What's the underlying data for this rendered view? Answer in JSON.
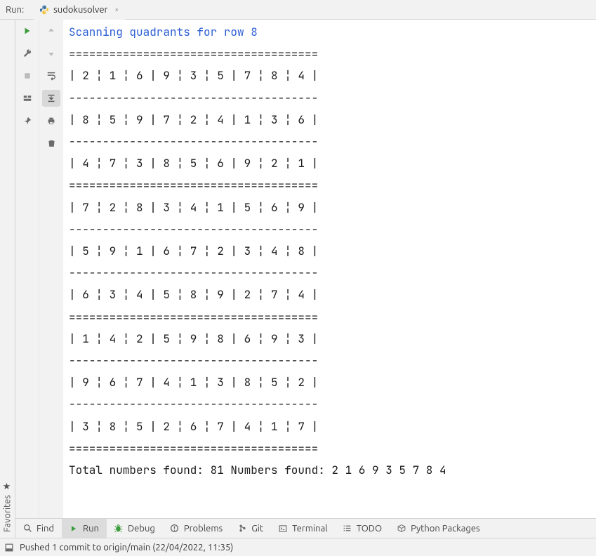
{
  "header": {
    "run_label": "Run:",
    "tab": {
      "icon": "python-file-icon",
      "title": "sudokusolver",
      "close": "×"
    }
  },
  "left_rail": {
    "favorites": {
      "icon": "★",
      "label": "Favorites"
    }
  },
  "console": {
    "lines": [
      {
        "cls": "system",
        "text": "Scanning quadrants for row 8"
      },
      {
        "cls": "",
        "text": "====================================="
      },
      {
        "cls": "",
        "text": "| 2 ¦ 1 ¦ 6 | 9 ¦ 3 ¦ 5 | 7 ¦ 8 ¦ 4 |"
      },
      {
        "cls": "",
        "text": "-------------------------------------"
      },
      {
        "cls": "",
        "text": "| 8 ¦ 5 ¦ 9 | 7 ¦ 2 ¦ 4 | 1 ¦ 3 ¦ 6 |"
      },
      {
        "cls": "",
        "text": "-------------------------------------"
      },
      {
        "cls": "",
        "text": "| 4 ¦ 7 ¦ 3 | 8 ¦ 5 ¦ 6 | 9 ¦ 2 ¦ 1 |"
      },
      {
        "cls": "",
        "text": "====================================="
      },
      {
        "cls": "",
        "text": "| 7 ¦ 2 ¦ 8 | 3 ¦ 4 ¦ 1 | 5 ¦ 6 ¦ 9 |"
      },
      {
        "cls": "",
        "text": "-------------------------------------"
      },
      {
        "cls": "",
        "text": "| 5 ¦ 9 ¦ 1 | 6 ¦ 7 ¦ 2 | 3 ¦ 4 ¦ 8 |"
      },
      {
        "cls": "",
        "text": "-------------------------------------"
      },
      {
        "cls": "",
        "text": "| 6 ¦ 3 ¦ 4 | 5 ¦ 8 ¦ 9 | 2 ¦ 7 ¦ 4 |"
      },
      {
        "cls": "",
        "text": "====================================="
      },
      {
        "cls": "",
        "text": "| 1 ¦ 4 ¦ 2 | 5 ¦ 9 ¦ 8 | 6 ¦ 9 ¦ 3 |"
      },
      {
        "cls": "",
        "text": "-------------------------------------"
      },
      {
        "cls": "",
        "text": "| 9 ¦ 6 ¦ 7 | 4 ¦ 1 ¦ 3 | 8 ¦ 5 ¦ 2 |"
      },
      {
        "cls": "",
        "text": "-------------------------------------"
      },
      {
        "cls": "",
        "text": "| 3 ¦ 8 ¦ 5 | 2 ¦ 6 ¦ 7 | 4 ¦ 1 ¦ 7 |"
      },
      {
        "cls": "",
        "text": "====================================="
      },
      {
        "cls": "",
        "text": ""
      },
      {
        "cls": "",
        "text": ""
      },
      {
        "cls": "",
        "text": "Total numbers found: 81 Numbers found: 2 1 6 9 3 5 7 8 4 "
      }
    ]
  },
  "bottom_tabs": [
    {
      "icon": "search-icon",
      "label": "Find",
      "active": false
    },
    {
      "icon": "play-icon",
      "label": "Run",
      "active": true
    },
    {
      "icon": "bug-icon",
      "label": "Debug",
      "active": false
    },
    {
      "icon": "warning-icon",
      "label": "Problems",
      "active": false
    },
    {
      "icon": "git-icon",
      "label": "Git",
      "active": false
    },
    {
      "icon": "terminal-icon",
      "label": "Terminal",
      "active": false
    },
    {
      "icon": "todo-icon",
      "label": "TODO",
      "active": false
    },
    {
      "icon": "packages-icon",
      "label": "Python Packages",
      "active": false
    }
  ],
  "status_bar": {
    "commit_message": "Pushed 1 commit to origin/main (22/04/2022, 11:35)"
  }
}
